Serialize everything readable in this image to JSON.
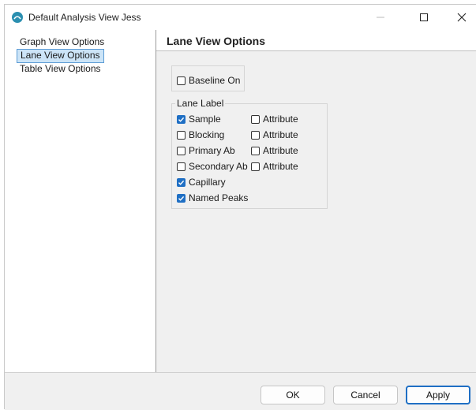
{
  "window": {
    "title": "Default Analysis View Jess"
  },
  "sidebar": {
    "items": [
      {
        "label": "Graph View Options"
      },
      {
        "label": "Lane View Options"
      },
      {
        "label": "Table View Options"
      }
    ]
  },
  "panel": {
    "title": "Lane View Options"
  },
  "options": {
    "baseline": {
      "label": "Baseline On",
      "checked": false
    },
    "lane_label": {
      "legend": "Lane Label",
      "rows": [
        {
          "label": "Sample",
          "checked": true,
          "attribute": {
            "label": "Attribute",
            "checked": false
          }
        },
        {
          "label": "Blocking",
          "checked": false,
          "attribute": {
            "label": "Attribute",
            "checked": false
          }
        },
        {
          "label": "Primary Ab",
          "checked": false,
          "attribute": {
            "label": "Attribute",
            "checked": false
          }
        },
        {
          "label": "Secondary Ab",
          "checked": false,
          "attribute": {
            "label": "Attribute",
            "checked": false
          }
        },
        {
          "label": "Capillary",
          "checked": true
        },
        {
          "label": "Named Peaks",
          "checked": true
        }
      ]
    }
  },
  "footer": {
    "ok": "OK",
    "cancel": "Cancel",
    "apply": "Apply"
  },
  "colors": {
    "accent": "#1f6fc4",
    "selection_bg": "#cce4f7",
    "app_icon": "#2b8fb0"
  },
  "icons": {
    "app": "app-logo-icon",
    "min": "minimize-icon",
    "max": "maximize-icon",
    "close": "close-icon"
  }
}
